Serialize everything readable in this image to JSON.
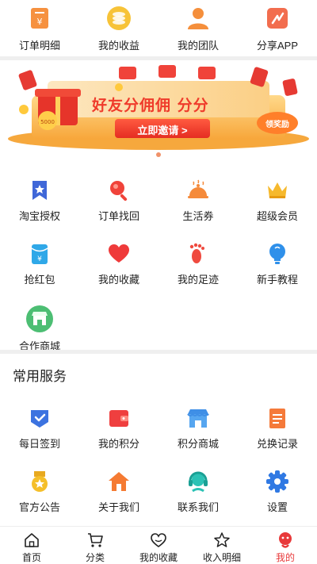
{
  "colors": {
    "accent": "#f38d3a",
    "active": "#e8393a",
    "divider": "#efefef"
  },
  "top_row": [
    {
      "label": "订单明细",
      "icon": "order-detail-icon"
    },
    {
      "label": "我的收益",
      "icon": "earnings-coin-icon"
    },
    {
      "label": "我的团队",
      "icon": "team-person-icon"
    },
    {
      "label": "分享APP",
      "icon": "share-app-icon"
    }
  ],
  "banner": {
    "headline": "好友分佣佣 分分",
    "button": "立即邀请 >",
    "badge": "领奖励",
    "gift_value": "5000"
  },
  "tools": [
    {
      "label": "淘宝授权",
      "icon": "bookmark-star-icon"
    },
    {
      "label": "订单找回",
      "icon": "search-icon"
    },
    {
      "label": "生活券",
      "icon": "food-cloche-icon"
    },
    {
      "label": "超级会员",
      "icon": "crown-icon"
    },
    {
      "label": "抢红包",
      "icon": "red-packet-icon"
    },
    {
      "label": "我的收藏",
      "icon": "heart-icon"
    },
    {
      "label": "我的足迹",
      "icon": "footprint-icon"
    },
    {
      "label": "新手教程",
      "icon": "lightbulb-icon"
    },
    {
      "label": "合作商城",
      "icon": "store-icon"
    }
  ],
  "section_title": "常用服务",
  "services": [
    {
      "label": "每日签到",
      "icon": "checkin-shield-icon"
    },
    {
      "label": "我的积分",
      "icon": "wallet-icon"
    },
    {
      "label": "积分商城",
      "icon": "shop-icon"
    },
    {
      "label": "兑换记录",
      "icon": "record-book-icon"
    },
    {
      "label": "官方公告",
      "icon": "medal-icon"
    },
    {
      "label": "关于我们",
      "icon": "house-icon"
    },
    {
      "label": "联系我们",
      "icon": "headset-icon"
    },
    {
      "label": "设置",
      "icon": "gear-icon"
    }
  ],
  "bottom_nav": [
    {
      "label": "首页",
      "icon": "home-icon"
    },
    {
      "label": "分类",
      "icon": "cart-icon"
    },
    {
      "label": "我的收藏",
      "icon": "heart-outline-icon"
    },
    {
      "label": "收入明细",
      "icon": "star-icon"
    },
    {
      "label": "我的",
      "icon": "profile-icon",
      "active": true
    }
  ]
}
